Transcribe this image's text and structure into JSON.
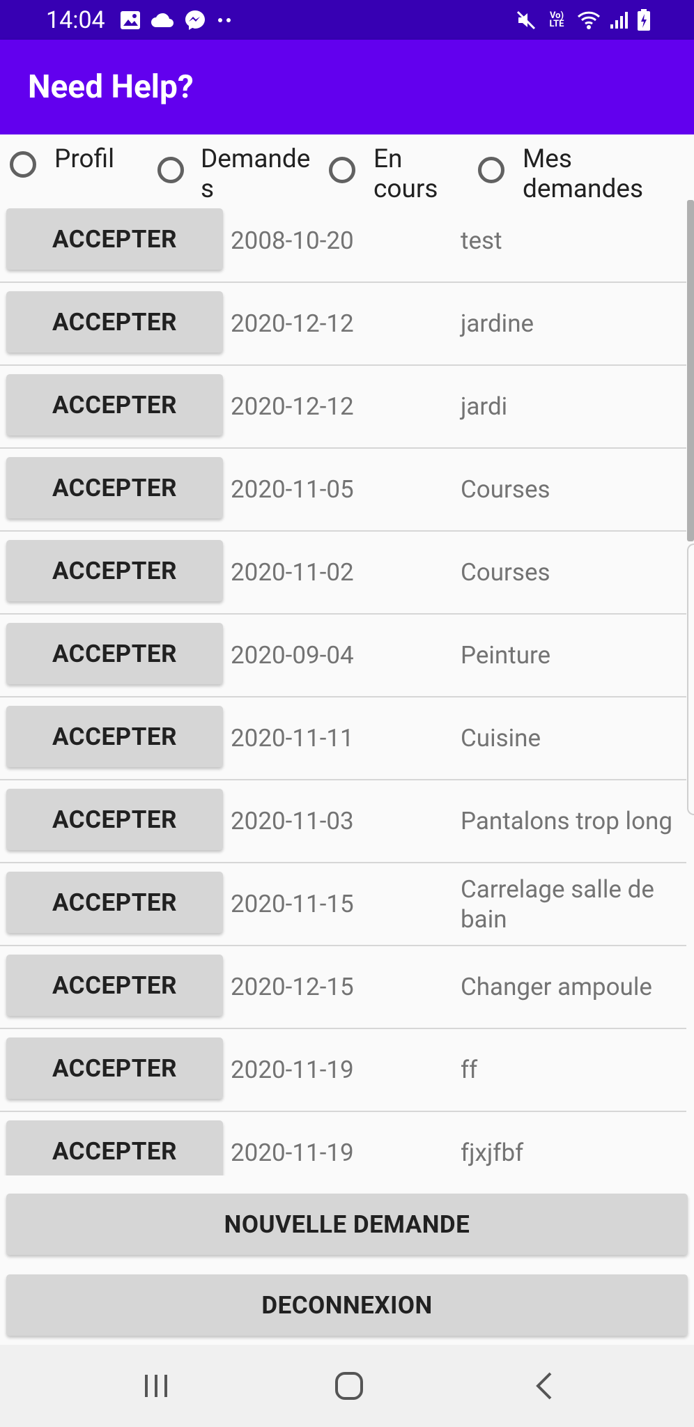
{
  "status_bar": {
    "time": "14:04",
    "left_icons": [
      "image-icon",
      "cloud-icon",
      "messenger-icon",
      "more-dots-icon"
    ],
    "right_icons": [
      "mute-icon",
      "volte-icon",
      "wifi-icon",
      "signal-icon",
      "battery-icon"
    ],
    "volte_label": "Vo) LTE"
  },
  "app_bar": {
    "title": "Need Help?",
    "color": "#6200ee"
  },
  "radio_group": {
    "options": [
      {
        "label": "Profil"
      },
      {
        "label": "Demandes"
      },
      {
        "label": "En cours"
      },
      {
        "label": "Mes demandes"
      }
    ]
  },
  "list": {
    "action_label": "ACCEPTER",
    "rows": [
      {
        "date": "2008-10-20",
        "title": "test"
      },
      {
        "date": "2020-12-12",
        "title": "jardine"
      },
      {
        "date": "2020-12-12",
        "title": "jardi"
      },
      {
        "date": "2020-11-05",
        "title": "Courses"
      },
      {
        "date": "2020-11-02",
        "title": "Courses"
      },
      {
        "date": "2020-09-04",
        "title": "Peinture"
      },
      {
        "date": "2020-11-11",
        "title": "Cuisine"
      },
      {
        "date": "2020-11-03",
        "title": "Pantalons trop long"
      },
      {
        "date": "2020-11-15",
        "title": "Carrelage salle de bain"
      },
      {
        "date": "2020-12-15",
        "title": "Changer ampoule"
      },
      {
        "date": "2020-11-19",
        "title": "ff"
      },
      {
        "date": "2020-11-19",
        "title": "fjxjfbf"
      }
    ]
  },
  "buttons": {
    "new_request": "NOUVELLE DEMANDE",
    "logout": "DECONNEXION"
  },
  "nav_bar": {
    "icons": [
      "recents-icon",
      "home-icon",
      "back-icon"
    ]
  }
}
